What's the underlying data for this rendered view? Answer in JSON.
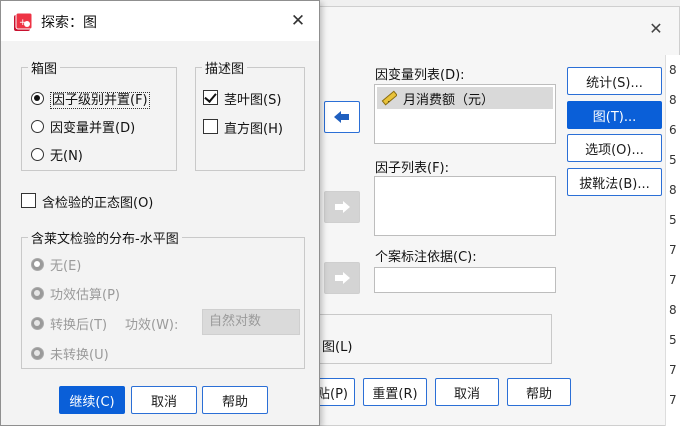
{
  "background_dialog": {
    "dependent_list_label": "因变量列表(D):",
    "dependent_items": [
      "月消费额（元）"
    ],
    "factor_list_label": "因子列表(F):",
    "case_label_label": "个案标注依据(C):",
    "bottom_area_label": "图(L)",
    "side_buttons": {
      "statistics": "统计(S)...",
      "plots": "图(T)...",
      "options": "选项(O)...",
      "bootstrap": "拔靴法(B)..."
    },
    "bottom_buttons": {
      "paste": "贴(P)",
      "reset": "重置(R)",
      "cancel": "取消",
      "help": "帮助"
    },
    "right_strip": [
      "8",
      "8",
      "6",
      "5",
      "8",
      "5",
      "7",
      "7",
      "8",
      "5",
      "7",
      "7"
    ]
  },
  "dialog": {
    "title": "探索：图",
    "boxplots": {
      "title": "箱图",
      "options": [
        "因子级别并置(F)",
        "因变量并置(D)",
        "无(N)"
      ],
      "selected": 0
    },
    "descriptive": {
      "title": "描述图",
      "stem_leaf": "茎叶图(S)",
      "stem_leaf_checked": true,
      "histogram": "直方图(H)",
      "histogram_checked": false
    },
    "normality": {
      "label": "含检验的正态图(O)",
      "checked": false
    },
    "levene": {
      "title": "含莱文检验的分布-水平图",
      "options": [
        "无(E)",
        "功效估算(P)",
        "转换后(T)",
        "未转换(U)"
      ],
      "selected": 0,
      "power_label": "功效(W):",
      "power_value": "自然对数"
    },
    "buttons": {
      "continue": "继续(C)",
      "cancel": "取消",
      "help": "帮助"
    }
  },
  "colors": {
    "accent": "#0a5fd8",
    "button_border": "#2b6fd6"
  }
}
